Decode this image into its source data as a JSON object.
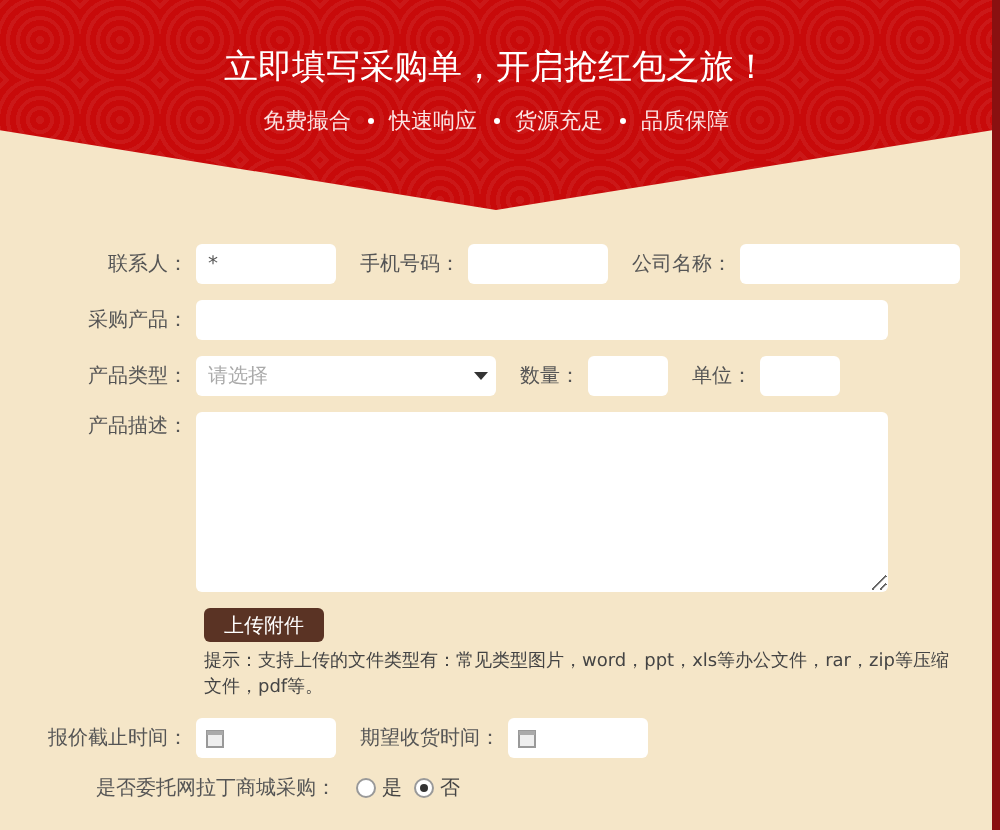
{
  "header": {
    "title": "立即填写采购单，开启抢红包之旅！",
    "features": [
      "免费撮合",
      "快速响应",
      "货源充足",
      "品质保障"
    ]
  },
  "contact": {
    "label": "联系人：",
    "value": "*"
  },
  "phone": {
    "label": "手机号码："
  },
  "company": {
    "label": "公司名称："
  },
  "product": {
    "label": "采购产品："
  },
  "product_type": {
    "label": "产品类型：",
    "placeholder": "请选择"
  },
  "quantity": {
    "label": "数量："
  },
  "unit": {
    "label": "单位："
  },
  "description": {
    "label": "产品描述："
  },
  "upload_button": "上传附件",
  "hint": "提示：支持上传的文件类型有：常见类型图片，word，ppt，xls等办公文件，rar，zip等压缩文件，pdf等。",
  "quote_deadline": {
    "label": "报价截止时间："
  },
  "delivery_date": {
    "label": "期望收货时间："
  },
  "delegate": {
    "label": "是否委托网拉丁商城采购：",
    "options": [
      {
        "label": "是",
        "selected": false
      },
      {
        "label": "否",
        "selected": true
      }
    ]
  }
}
